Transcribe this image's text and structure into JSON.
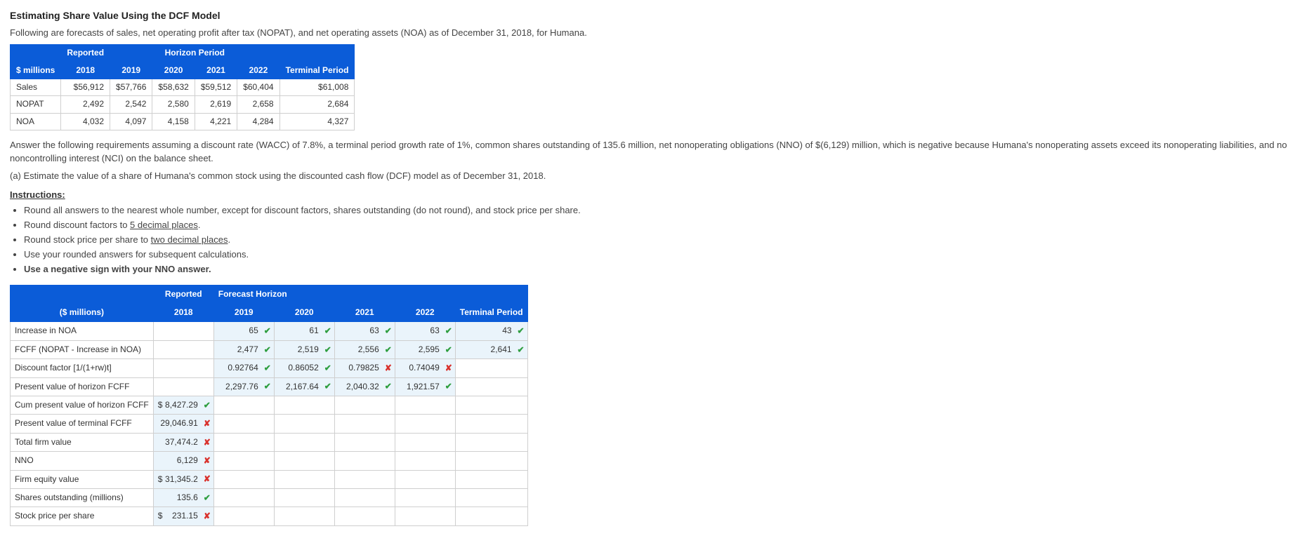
{
  "title": "Estimating Share Value Using the DCF Model",
  "intro": "Following are forecasts of sales, net operating profit after tax (NOPAT), and net operating assets (NOA) as of December 31, 2018, for Humana.",
  "forecast_table": {
    "group_headers": {
      "reported": "Reported",
      "horizon": "Horizon Period"
    },
    "col_headers": {
      "millions": "$ millions",
      "y2018": "2018",
      "y2019": "2019",
      "y2020": "2020",
      "y2021": "2021",
      "y2022": "2022",
      "terminal": "Terminal Period"
    },
    "rows": [
      {
        "label": "Sales",
        "v": [
          "$56,912",
          "$57,766",
          "$58,632",
          "$59,512",
          "$60,404",
          "$61,008"
        ]
      },
      {
        "label": "NOPAT",
        "v": [
          "2,492",
          "2,542",
          "2,580",
          "2,619",
          "2,658",
          "2,684"
        ]
      },
      {
        "label": "NOA",
        "v": [
          "4,032",
          "4,097",
          "4,158",
          "4,221",
          "4,284",
          "4,327"
        ]
      }
    ]
  },
  "assumptions": "Answer the following requirements assuming a discount rate (WACC) of 7.8%, a terminal period growth rate of 1%, common shares outstanding of 135.6 million, net nonoperating obligations (NNO) of $(6,129) million, which is negative because Humana's nonoperating assets exceed its nonoperating liabilities, and no noncontrolling interest (NCI) on the balance sheet.",
  "part_a": "(a) Estimate the value of a share of Humana's common stock using the discounted cash flow (DCF) model as of December 31, 2018.",
  "instructions_label": "Instructions:",
  "instructions": [
    {
      "pre": "Round all answers to the nearest whole number, except for discount factors, shares outstanding (do not round), and stock price per share.",
      "ul": "",
      "post": ""
    },
    {
      "pre": "Round discount factors to ",
      "ul": "5 decimal places",
      "post": "."
    },
    {
      "pre": "Round stock price per share to ",
      "ul": "two decimal places",
      "post": "."
    },
    {
      "pre": "Use your rounded answers for subsequent calculations.",
      "ul": "",
      "post": ""
    },
    {
      "pre": "Use a negative sign with your NNO answer.",
      "ul": "",
      "post": "",
      "bold": true
    }
  ],
  "dcf_table": {
    "group_headers": {
      "reported": "Reported",
      "forecast": "Forecast Horizon"
    },
    "col_headers": {
      "millions": "($ millions)",
      "y2018": "2018",
      "y2019": "2019",
      "y2020": "2020",
      "y2021": "2021",
      "y2022": "2022",
      "terminal": "Terminal Period"
    },
    "rows": [
      {
        "label": "Increase in NOA",
        "cells": [
          {
            "value": "",
            "status": "",
            "input": false
          },
          {
            "value": "65",
            "status": "correct",
            "input": true
          },
          {
            "value": "61",
            "status": "correct",
            "input": true
          },
          {
            "value": "63",
            "status": "correct",
            "input": true
          },
          {
            "value": "63",
            "status": "correct",
            "input": true
          },
          {
            "value": "43",
            "status": "correct",
            "input": true
          }
        ]
      },
      {
        "label": "FCFF (NOPAT - Increase in NOA)",
        "cells": [
          {
            "value": "",
            "status": "",
            "input": false
          },
          {
            "value": "2,477",
            "status": "correct",
            "input": true
          },
          {
            "value": "2,519",
            "status": "correct",
            "input": true
          },
          {
            "value": "2,556",
            "status": "correct",
            "input": true
          },
          {
            "value": "2,595",
            "status": "correct",
            "input": true
          },
          {
            "value": "2,641",
            "status": "correct",
            "input": true
          }
        ]
      },
      {
        "label": "Discount factor [1/(1+rw)t]",
        "cells": [
          {
            "value": "",
            "status": "",
            "input": false
          },
          {
            "value": "0.92764",
            "status": "correct",
            "input": true
          },
          {
            "value": "0.86052",
            "status": "correct",
            "input": true
          },
          {
            "value": "0.79825",
            "status": "wrong",
            "input": true
          },
          {
            "value": "0.74049",
            "status": "wrong",
            "input": true
          },
          {
            "value": "",
            "status": "",
            "input": false
          }
        ]
      },
      {
        "label": "Present value of horizon FCFF",
        "cells": [
          {
            "value": "",
            "status": "",
            "input": false
          },
          {
            "value": "2,297.76",
            "status": "correct",
            "input": true
          },
          {
            "value": "2,167.64",
            "status": "correct",
            "input": true
          },
          {
            "value": "2,040.32",
            "status": "correct",
            "input": true
          },
          {
            "value": "1,921.57",
            "status": "correct",
            "input": true
          },
          {
            "value": "",
            "status": "",
            "input": false
          }
        ]
      },
      {
        "label": "Cum present value of horizon FCFF",
        "cells": [
          {
            "prefix": "$",
            "value": "8,427.29",
            "status": "correct",
            "input": true
          },
          {
            "value": "",
            "status": "",
            "input": false
          },
          {
            "value": "",
            "status": "",
            "input": false
          },
          {
            "value": "",
            "status": "",
            "input": false
          },
          {
            "value": "",
            "status": "",
            "input": false
          },
          {
            "value": "",
            "status": "",
            "input": false
          }
        ]
      },
      {
        "label": "Present value of terminal FCFF",
        "cells": [
          {
            "value": "29,046.91",
            "status": "wrong",
            "input": true
          },
          {
            "value": "",
            "status": "",
            "input": false
          },
          {
            "value": "",
            "status": "",
            "input": false
          },
          {
            "value": "",
            "status": "",
            "input": false
          },
          {
            "value": "",
            "status": "",
            "input": false
          },
          {
            "value": "",
            "status": "",
            "input": false
          }
        ]
      },
      {
        "label": "Total firm value",
        "cells": [
          {
            "value": "37,474.2",
            "status": "wrong",
            "input": true
          },
          {
            "value": "",
            "status": "",
            "input": false
          },
          {
            "value": "",
            "status": "",
            "input": false
          },
          {
            "value": "",
            "status": "",
            "input": false
          },
          {
            "value": "",
            "status": "",
            "input": false
          },
          {
            "value": "",
            "status": "",
            "input": false
          }
        ]
      },
      {
        "label": "NNO",
        "cells": [
          {
            "value": "6,129",
            "status": "wrong",
            "input": true
          },
          {
            "value": "",
            "status": "",
            "input": false
          },
          {
            "value": "",
            "status": "",
            "input": false
          },
          {
            "value": "",
            "status": "",
            "input": false
          },
          {
            "value": "",
            "status": "",
            "input": false
          },
          {
            "value": "",
            "status": "",
            "input": false
          }
        ]
      },
      {
        "label": "Firm equity value",
        "cells": [
          {
            "prefix": "$",
            "value": "31,345.2",
            "status": "wrong",
            "input": true
          },
          {
            "value": "",
            "status": "",
            "input": false
          },
          {
            "value": "",
            "status": "",
            "input": false
          },
          {
            "value": "",
            "status": "",
            "input": false
          },
          {
            "value": "",
            "status": "",
            "input": false
          },
          {
            "value": "",
            "status": "",
            "input": false
          }
        ]
      },
      {
        "label": "Shares outstanding (millions)",
        "cells": [
          {
            "value": "135.6",
            "status": "correct",
            "input": true
          },
          {
            "value": "",
            "status": "",
            "input": false
          },
          {
            "value": "",
            "status": "",
            "input": false
          },
          {
            "value": "",
            "status": "",
            "input": false
          },
          {
            "value": "",
            "status": "",
            "input": false
          },
          {
            "value": "",
            "status": "",
            "input": false
          }
        ]
      },
      {
        "label": "Stock price per share",
        "cells": [
          {
            "prefix": "$",
            "value": "231.15",
            "status": "wrong",
            "input": true
          },
          {
            "value": "",
            "status": "",
            "input": false
          },
          {
            "value": "",
            "status": "",
            "input": false
          },
          {
            "value": "",
            "status": "",
            "input": false
          },
          {
            "value": "",
            "status": "",
            "input": false
          },
          {
            "value": "",
            "status": "",
            "input": false
          }
        ]
      }
    ]
  }
}
